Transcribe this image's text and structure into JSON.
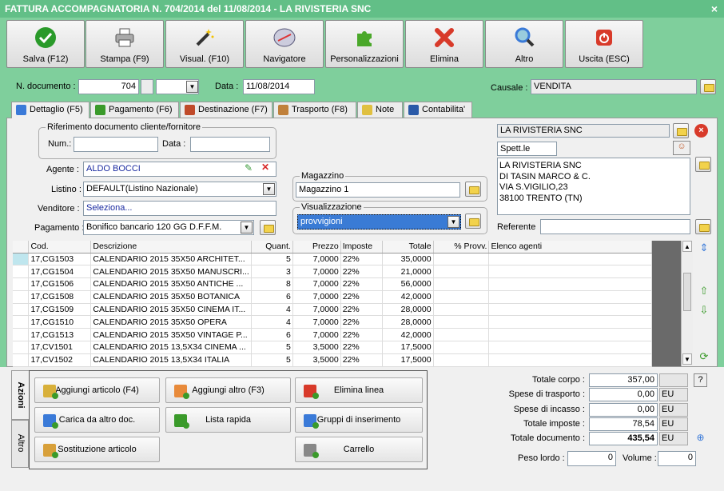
{
  "window": {
    "title": "FATTURA ACCOMPAGNATORIA N. 704/2014 del 11/08/2014 - LA RIVISTERIA SNC",
    "close": "×"
  },
  "toolbar": [
    {
      "label": "Salva (F12)",
      "icon": "check-icon",
      "color": "#2a9a2a"
    },
    {
      "label": "Stampa (F9)",
      "icon": "printer-icon",
      "color": "#777777"
    },
    {
      "label": "Visual. (F10)",
      "icon": "magic-wand-icon",
      "color": "#333333"
    },
    {
      "label": "Navigatore",
      "icon": "compass-icon",
      "color": "#6a6ab0"
    },
    {
      "label": "Personalizzazioni",
      "icon": "puzzle-icon",
      "color": "#4aa82a"
    },
    {
      "label": "Elimina",
      "icon": "cross-icon",
      "color": "#d83a2a"
    },
    {
      "label": "Altro",
      "icon": "magnifier-icon",
      "color": "#3a7ad8"
    },
    {
      "label": "Uscita (ESC)",
      "icon": "power-icon",
      "color": "#d83a2a"
    }
  ],
  "header": {
    "ndoc_label": "N. documento :",
    "ndoc_value": "704",
    "data_label": "Data :",
    "data_value": "11/08/2014",
    "causale_label": "Causale :",
    "causale_value": "VENDITA"
  },
  "tabs": [
    "Dettaglio (F5)",
    "Pagamento (F6)",
    "Destinazione (F7)",
    "Trasporto (F8)",
    "Note",
    "Contabilita'"
  ],
  "riferimento": {
    "title": "Riferimento documento cliente/fornitore",
    "num_label": "Num.:",
    "data_label": "Data :"
  },
  "fields": {
    "agente_label": "Agente :",
    "agente_value": "ALDO BOCCI",
    "listino_label": "Listino :",
    "listino_value": "DEFAULT(Listino Nazionale)",
    "venditore_label": "Venditore :",
    "venditore_value": "Seleziona...",
    "pagamento_label": "Pagamento :",
    "pagamento_value": "Bonifico bancario 120 GG D.F.F.M."
  },
  "magazzino": {
    "title": "Magazzino",
    "value": "Magazzino 1"
  },
  "visualizzazione": {
    "title": "Visualizzazione",
    "value": "provvigioni"
  },
  "cliente": {
    "name": "LA RIVISTERIA SNC",
    "prefix": "Spett.le",
    "address": [
      "LA RIVISTERIA SNC",
      "DI TASIN MARCO & C.",
      "VIA S.VIGILIO,23",
      "38100 TRENTO (TN)"
    ],
    "referente_label": "Referente"
  },
  "grid": {
    "columns": [
      "Cod.",
      "Descrizione",
      "Quant.",
      "Prezzo",
      "Imposte",
      "Totale",
      "% Provv.",
      "Elenco agenti"
    ],
    "rows": [
      [
        "17,CG1503",
        "CALENDARIO 2015 35X50 ARCHITET...",
        "5",
        "7,0000",
        "22%",
        "35,0000",
        "",
        ""
      ],
      [
        "17,CG1504",
        "CALENDARIO 2015 35X50 MANUSCRI...",
        "3",
        "7,0000",
        "22%",
        "21,0000",
        "",
        ""
      ],
      [
        "17,CG1506",
        "CALENDARIO 2015 35X50 ANTICHE ...",
        "8",
        "7,0000",
        "22%",
        "56,0000",
        "",
        ""
      ],
      [
        "17,CG1508",
        "CALENDARIO 2015 35X50 BOTANICA",
        "6",
        "7,0000",
        "22%",
        "42,0000",
        "",
        ""
      ],
      [
        "17,CG1509",
        "CALENDARIO 2015 35X50 CINEMA IT...",
        "4",
        "7,0000",
        "22%",
        "28,0000",
        "",
        ""
      ],
      [
        "17,CG1510",
        "CALENDARIO 2015 35X50 OPERA",
        "4",
        "7,0000",
        "22%",
        "28,0000",
        "",
        ""
      ],
      [
        "17,CG1513",
        "CALENDARIO 2015 35X50 VINTAGE P...",
        "6",
        "7,0000",
        "22%",
        "42,0000",
        "",
        ""
      ],
      [
        "17,CV1501",
        "CALENDARIO 2015 13,5X34 CINEMA ...",
        "5",
        "3,5000",
        "22%",
        "17,5000",
        "",
        ""
      ],
      [
        "17,CV1502",
        "CALENDARIO 2015 13,5X34 ITALIA",
        "5",
        "3,5000",
        "22%",
        "17,5000",
        "",
        ""
      ]
    ]
  },
  "side_tabs": [
    "Azioni",
    "Altro"
  ],
  "actions": [
    {
      "label": "Aggiungi articolo (F4)",
      "icon": "add-article-icon"
    },
    {
      "label": "Aggiungi altro (F3)",
      "icon": "add-other-icon"
    },
    {
      "label": "Elimina linea",
      "icon": "delete-line-icon"
    },
    {
      "label": "Carica da altro doc.",
      "icon": "load-doc-icon"
    },
    {
      "label": "Lista rapida",
      "icon": "quick-list-icon"
    },
    {
      "label": "Gruppi di inserimento",
      "icon": "insert-groups-icon"
    },
    {
      "label": "Sostituzione articolo",
      "icon": "replace-article-icon"
    },
    {
      "label": "",
      "icon": "blank"
    },
    {
      "label": "Carrello",
      "icon": "cart-icon"
    }
  ],
  "totals": {
    "corpo_label": "Totale corpo :",
    "corpo": "357,00",
    "trasporto_label": "Spese di trasporto :",
    "trasporto": "0,00",
    "incasso_label": "Spese di incasso :",
    "incasso": "0,00",
    "imposte_label": "Totale imposte :",
    "imposte": "78,54",
    "documento_label": "Totale documento :",
    "documento": "435,54",
    "eu": "EU",
    "help": "?",
    "peso_label": "Peso lordo :",
    "peso": "0",
    "volume_label": "Volume :",
    "volume": "0"
  }
}
